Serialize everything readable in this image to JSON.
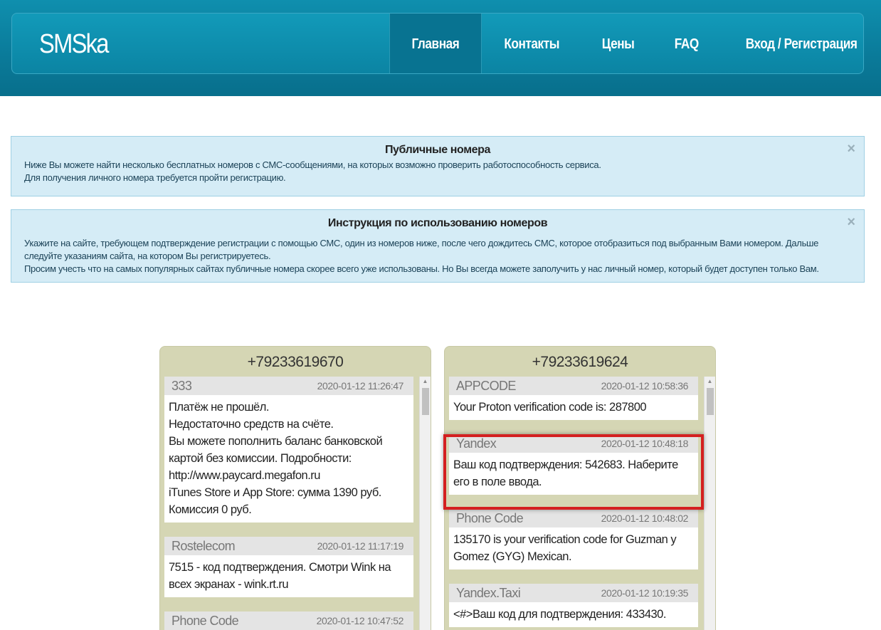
{
  "header": {
    "logo": "SMSka",
    "nav": [
      {
        "label": "Главная",
        "active": true
      },
      {
        "label": "Контакты",
        "active": false
      },
      {
        "label": "Цены",
        "active": false
      },
      {
        "label": "FAQ",
        "active": false
      },
      {
        "label": "Вход / Регистрация",
        "active": false
      }
    ]
  },
  "alerts": [
    {
      "title": "Публичные номера",
      "lines": [
        "Ниже Вы можете найти несколько бесплатных номеров с СМС-сообщениями, на которых возможно проверить работоспособность сервиса.",
        "Для получения личного номера требуется пройти регистрацию."
      ],
      "close": "×"
    },
    {
      "title": "Инструкция по использованию номеров",
      "lines": [
        "Укажите на сайте, требующем подтверждение регистрации с помощью СМС, один из номеров ниже, после чего дождитесь СМС, которое отобразиться под выбранным Вами номером. Дальше следуйте указаниям сайта, на котором Вы регистрируетесь.",
        "Просим учесть что на самых популярных сайтах публичные номера скорее всего уже использованы. Но Вы всегда можете заполучить у нас личный номер, который будет доступен только Вам."
      ],
      "close": "×"
    }
  ],
  "phones": [
    {
      "number": "+79233619670",
      "messages": [
        {
          "sender": "333",
          "time": "2020-01-12 11:26:47",
          "text": "Платёж не прошёл.\nНедостаточно средств на счёте.\nВы можете пополнить баланс банковской картой без комиссии. Подробности: http://www.paycard.megafon.ru\niTunes Store и App Store: сумма 1390 руб. Комиссия 0 руб."
        },
        {
          "sender": "Rostelecom",
          "time": "2020-01-12 11:17:19",
          "text": "7515 - код подтверждения. Смотри Wink на всех экранах - wink.rt.ru"
        },
        {
          "sender": "Phone Code",
          "time": "2020-01-12 10:47:52",
          "text": ""
        }
      ]
    },
    {
      "number": "+79233619624",
      "messages": [
        {
          "sender": "APPCODE",
          "time": "2020-01-12 10:58:36",
          "text": "Your Proton verification code is: 287800"
        },
        {
          "sender": "Yandex",
          "time": "2020-01-12 10:48:18",
          "text": "Ваш код подтверждения: 542683. Наберите его в поле ввода."
        },
        {
          "sender": "Phone Code",
          "time": "2020-01-12 10:48:02",
          "text": "135170 is your verification code for Guzman y Gomez (GYG) Mexican."
        },
        {
          "sender": "Yandex.Taxi",
          "time": "2020-01-12 10:19:35",
          "text": "<#>Ваш код для подтверждения: 433430."
        }
      ]
    }
  ],
  "colors": {
    "header": "#0a7a99",
    "alert_bg": "#d5ecf6",
    "panel_bg": "#d5d6b4",
    "highlight": "#d42020"
  }
}
